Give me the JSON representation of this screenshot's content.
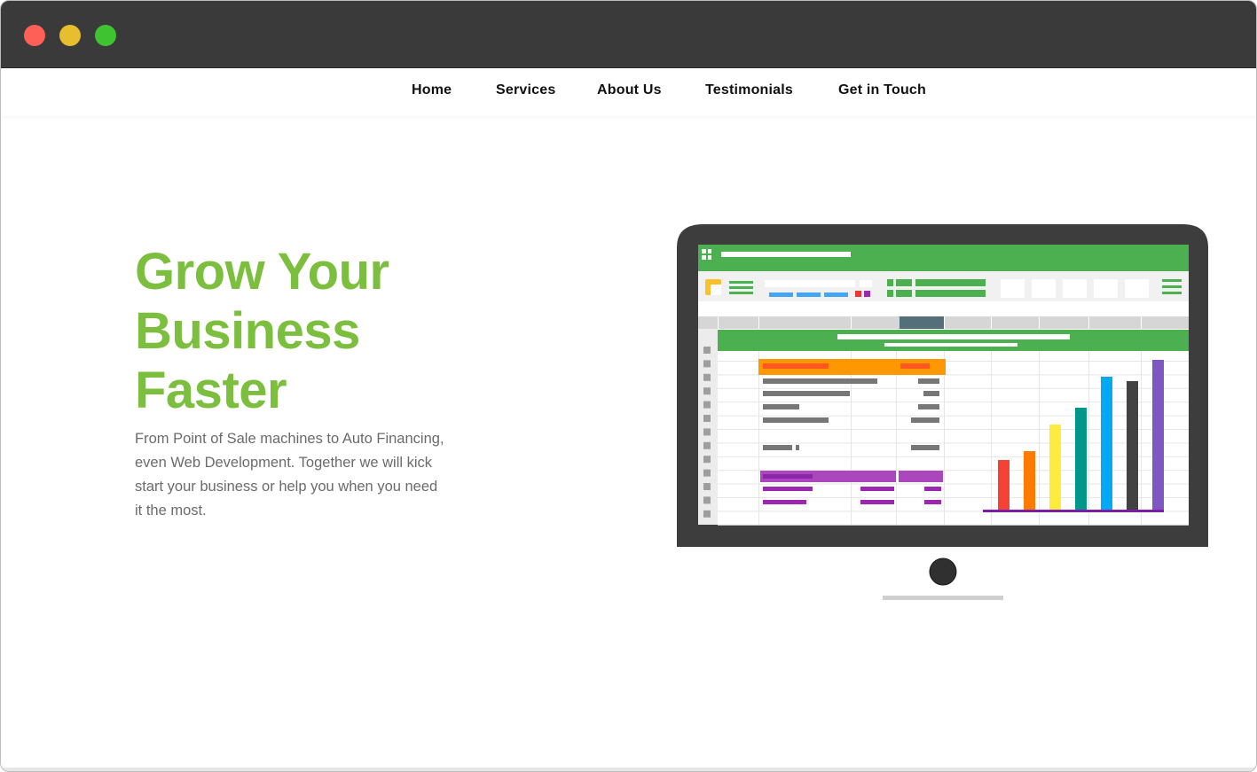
{
  "window": {
    "controls": [
      "close",
      "minimize",
      "maximize"
    ]
  },
  "nav": {
    "items": [
      {
        "label": "Home"
      },
      {
        "label": "Services"
      },
      {
        "label": "About Us"
      },
      {
        "label": "Testimonials"
      },
      {
        "label": "Get in Touch"
      }
    ]
  },
  "hero": {
    "title_lines": [
      "Grow Your",
      "Business",
      "Faster"
    ],
    "description": "From Point of Sale machines to Auto Financing, even Web Development. Together we will kick start your business or help you when you need it the most."
  },
  "illustration": {
    "icon": "spreadsheet-monitor-illustration",
    "bar_colors": [
      "#f44336",
      "#ff7a00",
      "#ffeb3b",
      "#009688",
      "#03a9f4",
      "#424242",
      "#7e57c2"
    ],
    "bar_values": [
      0.33,
      0.39,
      0.57,
      0.68,
      0.89,
      0.86,
      1.0
    ],
    "accent": "#4caf50",
    "title_color": "#7cbe3d"
  }
}
